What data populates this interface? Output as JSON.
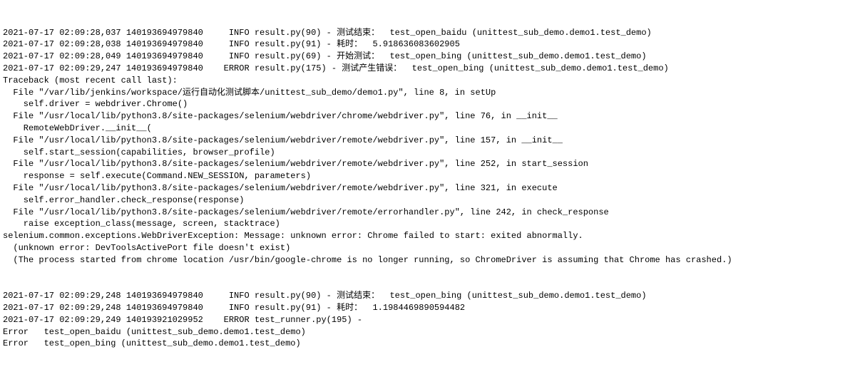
{
  "lines": [
    "2021-07-17 02:09:28,037 140193694979840     INFO result.py(90) - 测试结束：  test_open_baidu (unittest_sub_demo.demo1.test_demo)",
    "2021-07-17 02:09:28,038 140193694979840     INFO result.py(91) - 耗时：  5.918636083602905",
    "2021-07-17 02:09:28,049 140193694979840     INFO result.py(69) - 开始测试：  test_open_bing (unittest_sub_demo.demo1.test_demo)",
    "2021-07-17 02:09:29,247 140193694979840    ERROR result.py(175) - 测试产生错误：  test_open_bing (unittest_sub_demo.demo1.test_demo)",
    "Traceback (most recent call last):",
    "  File \"/var/lib/jenkins/workspace/运行自动化测试脚本/unittest_sub_demo/demo1.py\", line 8, in setUp",
    "    self.driver = webdriver.Chrome()",
    "  File \"/usr/local/lib/python3.8/site-packages/selenium/webdriver/chrome/webdriver.py\", line 76, in __init__",
    "    RemoteWebDriver.__init__(",
    "  File \"/usr/local/lib/python3.8/site-packages/selenium/webdriver/remote/webdriver.py\", line 157, in __init__",
    "    self.start_session(capabilities, browser_profile)",
    "  File \"/usr/local/lib/python3.8/site-packages/selenium/webdriver/remote/webdriver.py\", line 252, in start_session",
    "    response = self.execute(Command.NEW_SESSION, parameters)",
    "  File \"/usr/local/lib/python3.8/site-packages/selenium/webdriver/remote/webdriver.py\", line 321, in execute",
    "    self.error_handler.check_response(response)",
    "  File \"/usr/local/lib/python3.8/site-packages/selenium/webdriver/remote/errorhandler.py\", line 242, in check_response",
    "    raise exception_class(message, screen, stacktrace)",
    "selenium.common.exceptions.WebDriverException: Message: unknown error: Chrome failed to start: exited abnormally.",
    "  (unknown error: DevToolsActivePort file doesn't exist)",
    "  (The process started from chrome location /usr/bin/google-chrome is no longer running, so ChromeDriver is assuming that Chrome has crashed.)",
    "",
    "",
    "2021-07-17 02:09:29,248 140193694979840     INFO result.py(90) - 测试结束：  test_open_bing (unittest_sub_demo.demo1.test_demo)",
    "2021-07-17 02:09:29,248 140193694979840     INFO result.py(91) - 耗时：  1.1984469890594482",
    "2021-07-17 02:09:29,249 140193921029952    ERROR test_runner.py(195) - ",
    "Error   test_open_baidu (unittest_sub_demo.demo1.test_demo)",
    "Error   test_open_bing (unittest_sub_demo.demo1.test_demo)"
  ]
}
